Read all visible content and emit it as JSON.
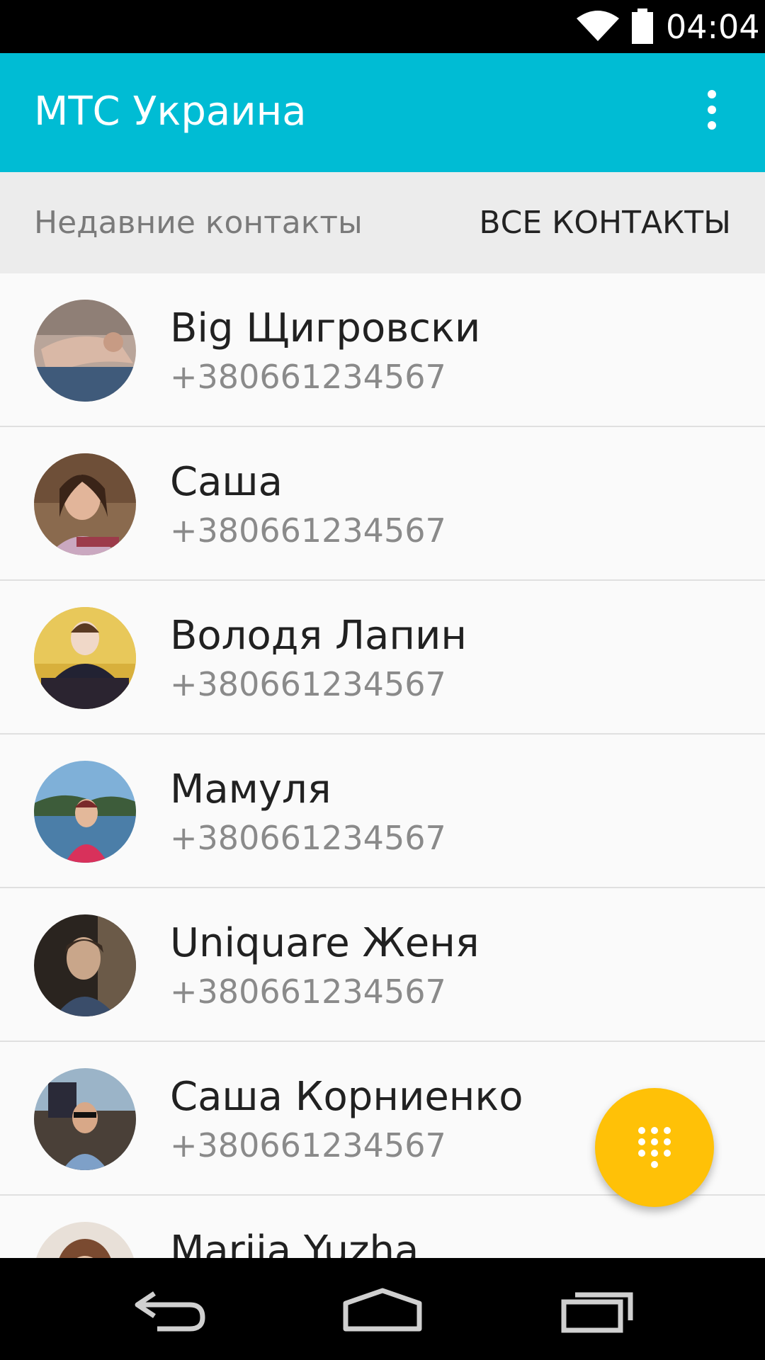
{
  "status_bar": {
    "time": "04:04",
    "icons": [
      "wifi-icon",
      "battery-icon"
    ]
  },
  "app_bar": {
    "title": "МТС Украина",
    "menu_icon": "overflow-menu-icon"
  },
  "tabs": {
    "recent": "Недавние контакты",
    "all": "ВСЕ КОНТАКТЫ"
  },
  "contacts": [
    {
      "name": "Big Щигровски",
      "phone": "+380661234567"
    },
    {
      "name": "Саша",
      "phone": "+380661234567"
    },
    {
      "name": "Володя Лапин",
      "phone": "+380661234567"
    },
    {
      "name": "Мамуля",
      "phone": "+380661234567"
    },
    {
      "name": "Uniquare Женя",
      "phone": "+380661234567"
    },
    {
      "name": "Саша Корниенко",
      "phone": "+380661234567"
    },
    {
      "name": "Marija Yuzha",
      "phone": ""
    }
  ],
  "fab": {
    "icon": "dialpad-icon",
    "color": "#ffc107"
  },
  "colors": {
    "app_bar": "#00bcd4",
    "tabs_bg": "#ececec",
    "list_bg": "#fafafa"
  },
  "nav_bar": {
    "icons": [
      "back-icon",
      "home-icon",
      "recents-icon"
    ]
  }
}
